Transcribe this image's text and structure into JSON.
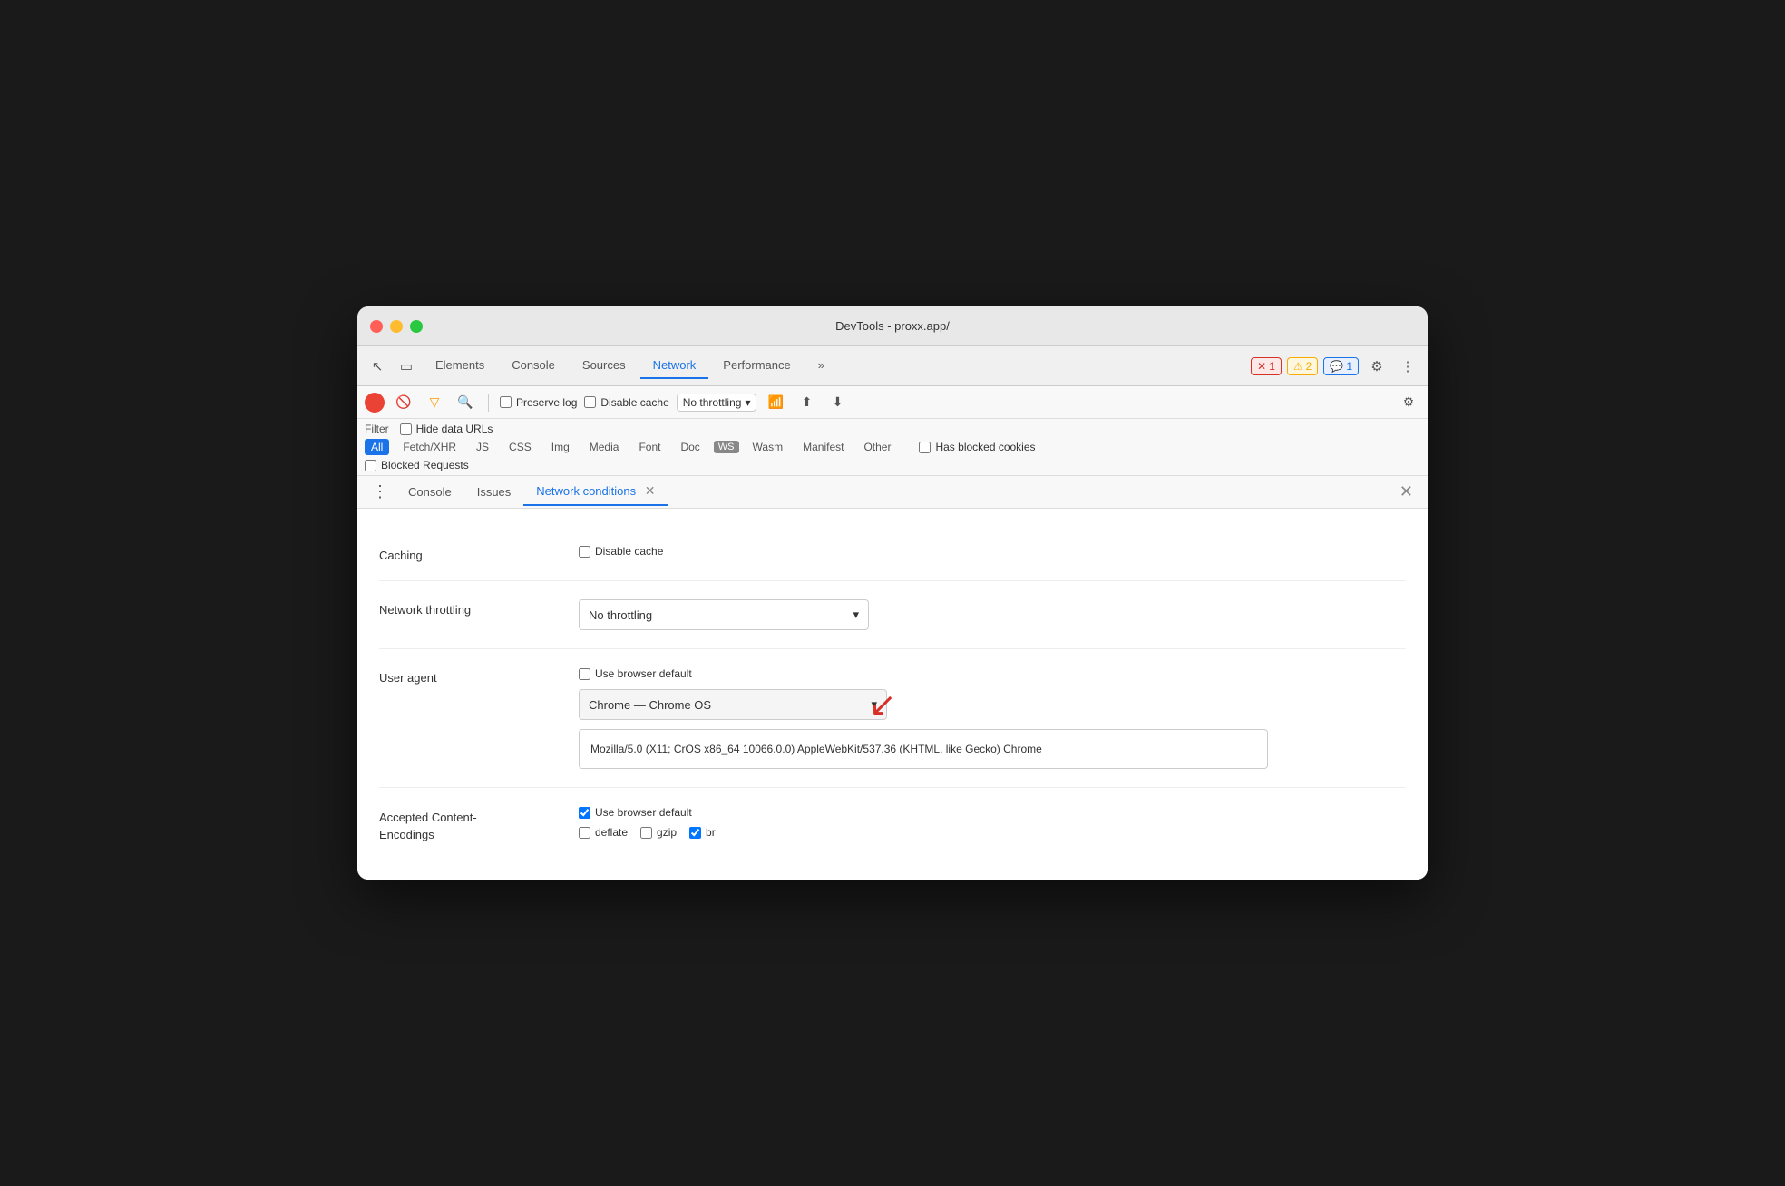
{
  "titleBar": {
    "title": "DevTools - proxx.app/"
  },
  "tabs": {
    "items": [
      {
        "id": "elements",
        "label": "Elements",
        "active": false
      },
      {
        "id": "console",
        "label": "Console",
        "active": false
      },
      {
        "id": "sources",
        "label": "Sources",
        "active": false
      },
      {
        "id": "network",
        "label": "Network",
        "active": true
      },
      {
        "id": "performance",
        "label": "Performance",
        "active": false
      },
      {
        "id": "more",
        "label": "»",
        "active": false
      }
    ]
  },
  "badges": {
    "error": {
      "icon": "✕",
      "count": "1"
    },
    "warning": {
      "icon": "⚠",
      "count": "2"
    },
    "info": {
      "icon": "💬",
      "count": "1"
    }
  },
  "networkToolbar": {
    "preserveLog": "Preserve log",
    "disableCache": "Disable cache",
    "throttle": "No throttling"
  },
  "filterBar": {
    "label": "Filter",
    "hideDataUrls": "Hide data URLs",
    "types": [
      "All",
      "Fetch/XHR",
      "JS",
      "CSS",
      "Img",
      "Media",
      "Font",
      "Doc",
      "WS",
      "Wasm",
      "Manifest",
      "Other"
    ],
    "hasBlockedCookies": "Has blocked cookies",
    "blockedRequests": "Blocked Requests"
  },
  "bottomPanel": {
    "tabs": [
      {
        "id": "console",
        "label": "Console",
        "active": false
      },
      {
        "id": "issues",
        "label": "Issues",
        "active": false
      },
      {
        "id": "network-conditions",
        "label": "Network conditions",
        "active": true
      }
    ]
  },
  "networkConditions": {
    "caching": {
      "label": "Caching",
      "disableCache": "Disable cache"
    },
    "throttling": {
      "label": "Network throttling",
      "value": "No throttling"
    },
    "userAgent": {
      "label": "User agent",
      "useBrowserDefault": "Use browser default",
      "selectedUA": "Chrome — Chrome OS",
      "uaString": "Mozilla/5.0 (X11; CrOS x86_64 10066.0.0) AppleWebKit/537.36 (KHTML, like Gecko) Chrome"
    },
    "encodings": {
      "label": "Accepted Content-\nEncodings",
      "useBrowserDefault": "Use browser default",
      "options": [
        {
          "id": "deflate",
          "label": "deflate",
          "checked": false
        },
        {
          "id": "gzip",
          "label": "gzip",
          "checked": false
        },
        {
          "id": "br",
          "label": "br",
          "checked": true
        }
      ]
    }
  }
}
